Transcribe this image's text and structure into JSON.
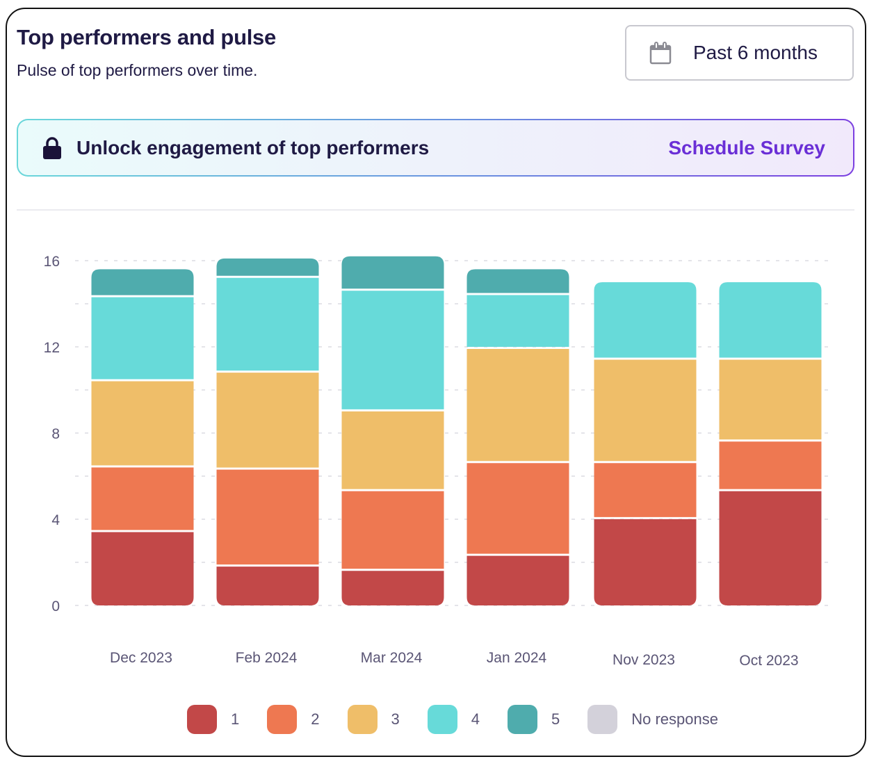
{
  "header": {
    "title": "Top performers and pulse",
    "subtitle": "Pulse of top performers over time."
  },
  "date_filter": {
    "icon": "calendar-icon",
    "label": "Past 6 months"
  },
  "banner": {
    "icon": "lock-icon",
    "message": "Unlock engagement of top performers",
    "cta_label": "Schedule Survey",
    "cta_color": "#6a2fd6"
  },
  "chart_data": {
    "type": "bar",
    "stacked": true,
    "title": "",
    "xlabel": "",
    "ylabel": "",
    "ylim": [
      0,
      16
    ],
    "yticks": [
      0,
      4,
      8,
      12,
      16
    ],
    "grid": true,
    "legend_position": "bottom",
    "categories": [
      "Dec 2023",
      "Feb 2024",
      "Mar 2024",
      "Jan 2024",
      "Nov 2023",
      "Oct 2023"
    ],
    "series": [
      {
        "name": "1",
        "color": "#c24848",
        "values": [
          3.5,
          1.9,
          1.7,
          2.4,
          4.1,
          5.4
        ]
      },
      {
        "name": "2",
        "color": "#ee7851",
        "values": [
          3.0,
          4.5,
          3.7,
          4.3,
          2.6,
          2.3
        ]
      },
      {
        "name": "3",
        "color": "#efbe69",
        "values": [
          4.0,
          4.5,
          3.7,
          5.3,
          4.8,
          3.8
        ]
      },
      {
        "name": "4",
        "color": "#67dad9",
        "values": [
          3.9,
          4.4,
          5.6,
          2.5,
          3.5,
          3.5
        ]
      },
      {
        "name": "5",
        "color": "#4facad",
        "values": [
          1.2,
          0.8,
          1.5,
          1.1,
          0,
          0
        ]
      },
      {
        "name": "No response",
        "color": "#d3d1da",
        "values": [
          0,
          0,
          0,
          0,
          0,
          0
        ]
      }
    ]
  }
}
